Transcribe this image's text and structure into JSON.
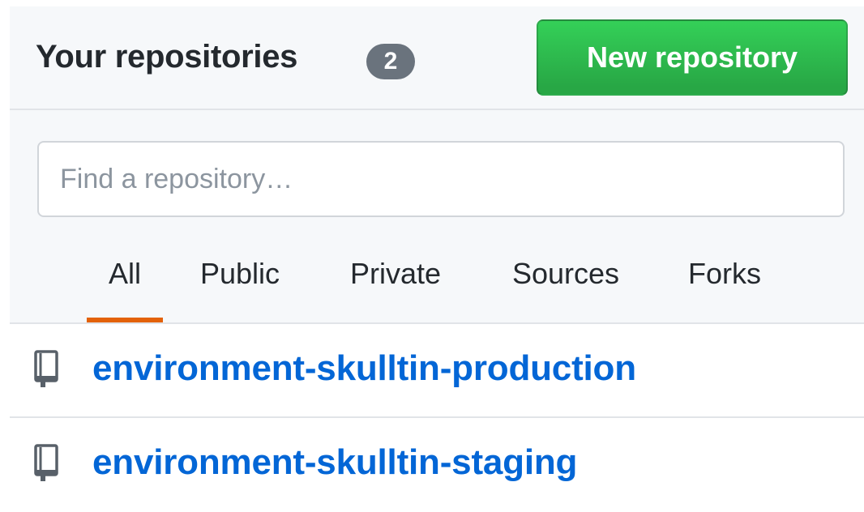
{
  "header": {
    "title": "Your repositories",
    "count": "2",
    "new_button_label": "New repository"
  },
  "search": {
    "placeholder": "Find a repository…",
    "value": ""
  },
  "tabs": [
    {
      "label": "All",
      "selected": true
    },
    {
      "label": "Public",
      "selected": false
    },
    {
      "label": "Private",
      "selected": false
    },
    {
      "label": "Sources",
      "selected": false
    },
    {
      "label": "Forks",
      "selected": false
    }
  ],
  "repositories": [
    {
      "name": "environment-skulltin-production",
      "icon": "repo-icon"
    },
    {
      "name": "environment-skulltin-staging",
      "icon": "repo-icon"
    }
  ],
  "colors": {
    "accent_green": "#28a745",
    "link_blue": "#0366d6",
    "selected_tab_underline": "#e36209",
    "badge_gray": "#6a737d"
  }
}
